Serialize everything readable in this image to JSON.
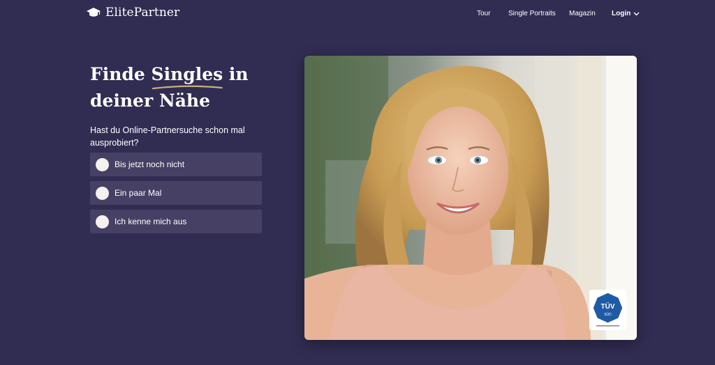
{
  "header": {
    "brand": "ElitePartner",
    "nav": {
      "tour": "Tour",
      "portraits": "Single Portraits",
      "magazin": "Magazin",
      "login": "Login"
    }
  },
  "hero": {
    "headline_pre": "Finde ",
    "headline_highlight": "Singles",
    "headline_post": " in deiner Nähe",
    "question": "Hast du Online-Partnersuche schon mal ausprobiert?",
    "options": [
      {
        "label": "Bis jetzt noch nicht"
      },
      {
        "label": "Ein paar Mal"
      },
      {
        "label": "Ich kenne mich aus"
      }
    ]
  },
  "badge": {
    "title": "TÜV",
    "sub": "SÜD"
  },
  "colors": {
    "background": "#312c52",
    "option_bg": "#464064",
    "accent_underline": "#c7b27a",
    "radio": "#f4f1ee"
  },
  "icons": {
    "logo": "graduation-cap-icon",
    "login_caret": "chevron-down-icon"
  }
}
